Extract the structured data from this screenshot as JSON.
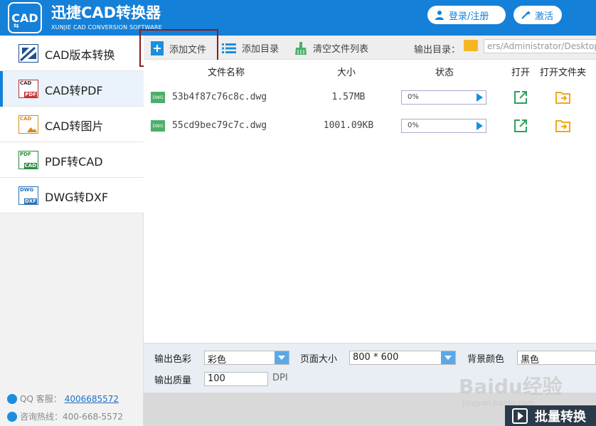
{
  "header": {
    "logo_text": "CAD",
    "title": "迅捷CAD转换器",
    "subtitle": "XUNJIE CAD CONVERSION SOFTWARE",
    "login_label": "登录/注册",
    "activate_label": "激活"
  },
  "sidebar": {
    "items": [
      {
        "label": "CAD版本转换",
        "icon_top": "",
        "icon_bottom": "",
        "active": false
      },
      {
        "label": "CAD转PDF",
        "icon_top": "CAD",
        "icon_bottom": "PDF",
        "active": true
      },
      {
        "label": "CAD转图片",
        "icon_top": "CAD",
        "icon_bottom": "",
        "active": false
      },
      {
        "label": "PDF转CAD",
        "icon_top": "PDF",
        "icon_bottom": "CAD",
        "active": false
      },
      {
        "label": "DWG转DXF",
        "icon_top": "DWG",
        "icon_bottom": "DXF",
        "active": false
      }
    ],
    "qq_label": "QQ 客服：",
    "qq_number": "4006685572",
    "hotline_label": "咨询热线：400-668-5572"
  },
  "toolbar": {
    "add_file": "添加文件",
    "add_dir": "添加目录",
    "clear_list": "清空文件列表",
    "output_label": "输出目录：",
    "output_path": "ers/Administrator/Desktop"
  },
  "table": {
    "headers": {
      "name": "文件名称",
      "size": "大小",
      "status": "状态",
      "open": "打开",
      "open_folder": "打开文件夹"
    },
    "rows": [
      {
        "icon": "DWG",
        "name": "53b4f87c76c8c.dwg",
        "size": "1.57MB",
        "progress": "0%"
      },
      {
        "icon": "DWG",
        "name": "55cd9bec79c7c.dwg",
        "size": "1001.09KB",
        "progress": "0%"
      }
    ]
  },
  "settings": {
    "color_label": "输出色彩",
    "color_value": "彩色",
    "page_label": "页面大小",
    "page_value": "800 * 600",
    "bg_label": "背景颜色",
    "bg_value": "黑色",
    "quality_label": "输出质量",
    "quality_value": "100",
    "quality_unit": "DPI"
  },
  "convert_label": "批量转换",
  "watermark": {
    "brand": "Baidu经验",
    "url": "jingyan.baidu.com"
  },
  "colors": {
    "accent": "#1580d8",
    "highlight_box": "#8b1c1c"
  }
}
